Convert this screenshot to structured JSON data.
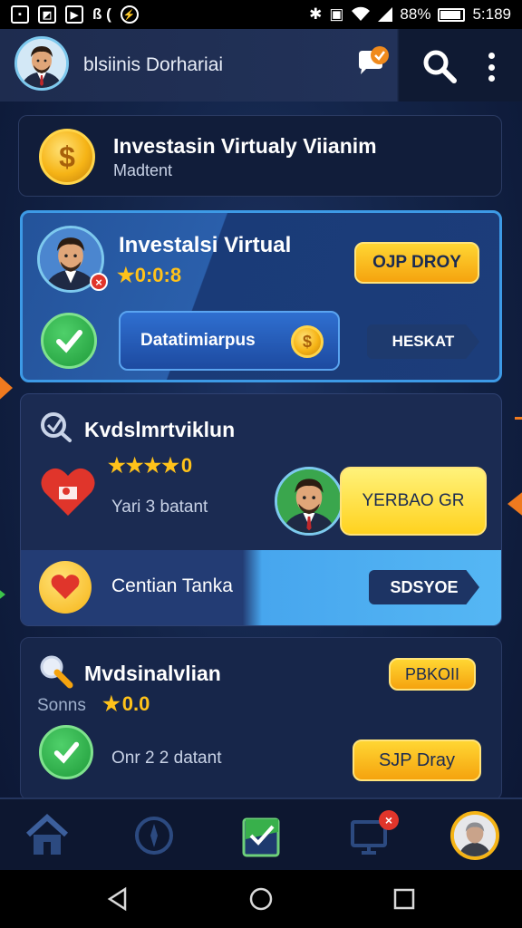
{
  "status_bar": {
    "left_icons": [
      "image-icon",
      "photo-icon",
      "gallery-icon",
      "music-icon",
      "messenger-icon"
    ],
    "left_text": "ß (",
    "battery": "88%",
    "time": "5:189"
  },
  "header": {
    "title": "blsiinis Dorhariai"
  },
  "card_top": {
    "title": "Investasin Virtualy Viianim",
    "subtitle": "Madtent"
  },
  "card_featured": {
    "title": "Investalsi Virtual",
    "rating": "★0:0:8",
    "action_button": "OJP DROY",
    "wide_button": "Datatimiarpus",
    "nav_button": "HESKAT"
  },
  "card_middle": {
    "title": "Kvdslmrtviklun",
    "stars": "★★★★",
    "stars_value": "0",
    "subtitle": "Yari 3 batant",
    "promo_button": "YERBAO GR",
    "footer_label": "Centian Tanka",
    "footer_button": "SDSYOE"
  },
  "card_bottom": {
    "title": "Mvdsinalvlian",
    "badge": "PBKOII",
    "label_left": "Sonns",
    "rating": "0.0",
    "subtitle": "Onr 2 2 datant",
    "action_button": "SJP Dray"
  },
  "bottom_nav": {
    "items": [
      "home-icon",
      "compass-icon",
      "wallet-icon",
      "monitor-icon",
      "profile-icon"
    ]
  },
  "colors": {
    "accent_blue": "#3d9ae6",
    "accent_yellow": "#f5a30e",
    "success_green": "#1f9b3a",
    "notification_red": "#e0352b"
  }
}
